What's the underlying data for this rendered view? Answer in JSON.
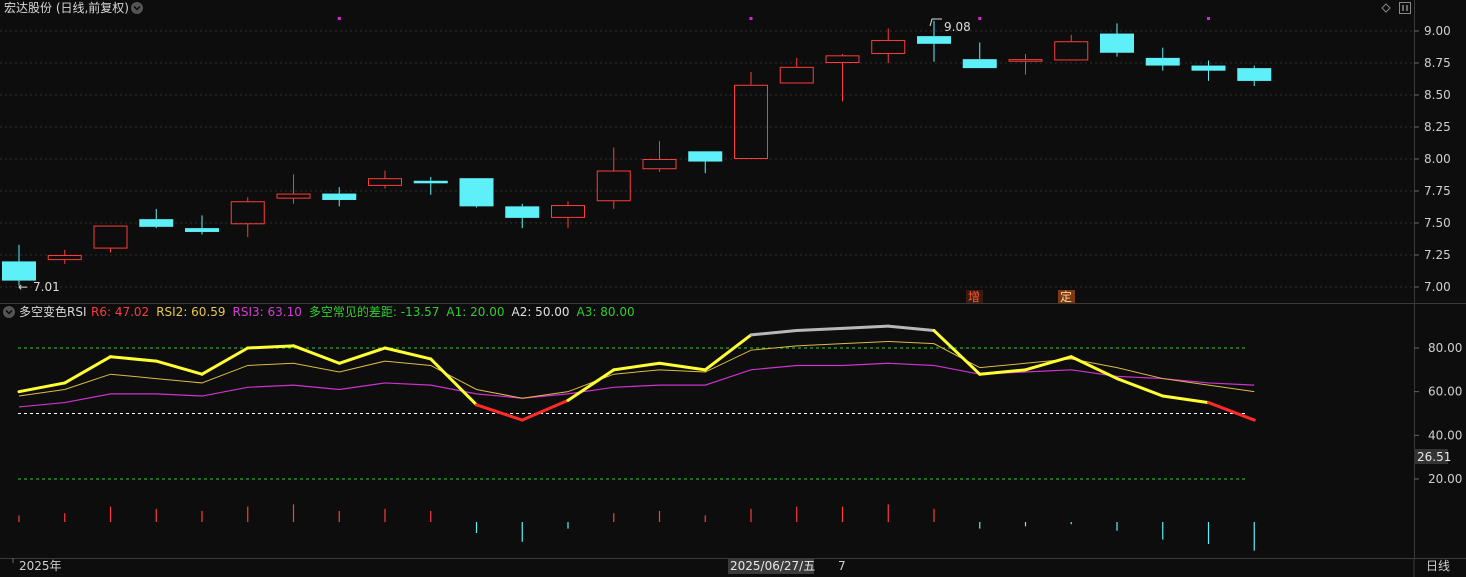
{
  "header": {
    "title": "宏达股份 (日线,前复权)",
    "rsi_title": "多空变色RSI",
    "period": "日线"
  },
  "colors": {
    "background": "#0d0d0d",
    "up": "#ff3b3b",
    "down": "#5ef0f8",
    "rsi_main": "#ffff33",
    "rsi_weak": "#ff2a2a",
    "rsi_strong": "#b8b8b8",
    "rsi2": "#ddbb44",
    "rsi3": "#cc33cc",
    "guide": "#33cc33",
    "mid": "#ffffff",
    "marker": "#e020e0"
  },
  "rsi_legend": [
    {
      "label": "R6: 47.02",
      "color": "#ff3b3b"
    },
    {
      "label": "RSI2: 60.59",
      "color": "#e8c84a"
    },
    {
      "label": "RSI3: 63.10",
      "color": "#d040d0"
    },
    {
      "label": "多空常见的差距: -13.57",
      "color": "#33cc33"
    },
    {
      "label": "A1: 20.00",
      "color": "#33cc33"
    },
    {
      "label": "A2: 50.00",
      "color": "#e0e0e0"
    },
    {
      "label": "A3: 80.00",
      "color": "#33cc33"
    }
  ],
  "annotations": {
    "high_label": "9.08",
    "low_label": "7.01",
    "events": [
      "增",
      "定"
    ],
    "crosshair_value": "26.51"
  },
  "x_axis": {
    "year_label": "2025年",
    "cursor_date": "2025/06/27/五",
    "tail_label": "7"
  },
  "chart_data": [
    {
      "type": "candlestick",
      "title": "宏达股份 (日线,前复权)",
      "y_ticks": [
        "9.00",
        "8.75",
        "8.50",
        "8.25",
        "8.00",
        "7.75",
        "7.50",
        "7.25",
        "7.00"
      ],
      "ylim": [
        6.97,
        9.1
      ],
      "candles": [
        {
          "o": 7.2,
          "h": 7.33,
          "l": 7.01,
          "c": 7.05
        },
        {
          "o": 7.21,
          "h": 7.29,
          "l": 7.18,
          "c": 7.25
        },
        {
          "o": 7.3,
          "h": 7.48,
          "l": 7.27,
          "c": 7.48
        },
        {
          "o": 7.53,
          "h": 7.61,
          "l": 7.46,
          "c": 7.47
        },
        {
          "o": 7.46,
          "h": 7.56,
          "l": 7.41,
          "c": 7.43
        },
        {
          "o": 7.49,
          "h": 7.7,
          "l": 7.39,
          "c": 7.67
        },
        {
          "o": 7.69,
          "h": 7.88,
          "l": 7.65,
          "c": 7.73
        },
        {
          "o": 7.73,
          "h": 7.78,
          "l": 7.63,
          "c": 7.68
        },
        {
          "o": 7.79,
          "h": 7.91,
          "l": 7.77,
          "c": 7.85
        },
        {
          "o": 7.83,
          "h": 7.86,
          "l": 7.72,
          "c": 7.81
        },
        {
          "o": 7.85,
          "h": 7.85,
          "l": 7.62,
          "c": 7.63
        },
        {
          "o": 7.63,
          "h": 7.65,
          "l": 7.46,
          "c": 7.54
        },
        {
          "o": 7.54,
          "h": 7.67,
          "l": 7.46,
          "c": 7.64
        },
        {
          "o": 7.67,
          "h": 8.09,
          "l": 7.61,
          "c": 7.91
        },
        {
          "o": 7.92,
          "h": 8.14,
          "l": 7.9,
          "c": 8.0
        },
        {
          "o": 8.06,
          "h": 8.06,
          "l": 7.89,
          "c": 7.98
        },
        {
          "o": 8.0,
          "h": 8.68,
          "l": 8.0,
          "c": 8.58
        },
        {
          "o": 8.59,
          "h": 8.79,
          "l": 8.59,
          "c": 8.72
        },
        {
          "o": 8.75,
          "h": 8.82,
          "l": 8.45,
          "c": 8.81
        },
        {
          "o": 8.82,
          "h": 9.02,
          "l": 8.75,
          "c": 8.93
        },
        {
          "o": 8.96,
          "h": 9.08,
          "l": 8.76,
          "c": 8.9
        },
        {
          "o": 8.78,
          "h": 8.91,
          "l": 8.71,
          "c": 8.71
        },
        {
          "o": 8.76,
          "h": 8.82,
          "l": 8.66,
          "c": 8.78
        },
        {
          "o": 8.77,
          "h": 8.97,
          "l": 8.77,
          "c": 8.92
        },
        {
          "o": 8.98,
          "h": 9.06,
          "l": 8.8,
          "c": 8.83
        },
        {
          "o": 8.79,
          "h": 8.87,
          "l": 8.69,
          "c": 8.73
        },
        {
          "o": 8.73,
          "h": 8.77,
          "l": 8.61,
          "c": 8.69
        },
        {
          "o": 8.71,
          "h": 8.73,
          "l": 8.57,
          "c": 8.61
        }
      ],
      "top_markers": [
        7,
        16,
        21,
        26
      ]
    },
    {
      "type": "line",
      "title": "多空变色RSI",
      "y_ticks": [
        "80.00",
        "60.00",
        "40.00",
        "20.00"
      ],
      "ylim": [
        0,
        100
      ],
      "guides": [
        20,
        50,
        80
      ],
      "series": [
        {
          "name": "R6",
          "values": [
            60,
            64,
            76,
            74,
            68,
            80,
            81,
            73,
            80,
            75,
            54,
            47,
            56,
            70,
            73,
            70,
            86,
            88,
            89,
            90,
            88,
            68,
            70,
            76,
            66,
            58,
            55,
            47
          ]
        },
        {
          "name": "RSI2",
          "values": [
            58,
            61,
            68,
            66,
            64,
            72,
            73,
            69,
            74,
            72,
            61,
            57,
            60,
            68,
            70,
            69,
            79,
            81,
            82,
            83,
            82,
            71,
            73,
            75,
            71,
            66,
            63,
            60
          ]
        },
        {
          "name": "RSI3",
          "values": [
            53,
            55,
            59,
            59,
            58,
            62,
            63,
            61,
            64,
            63,
            59,
            57,
            59,
            62,
            63,
            63,
            70,
            72,
            72,
            73,
            72,
            68,
            69,
            70,
            67,
            66,
            64,
            63
          ]
        }
      ],
      "bars": [
        3,
        4,
        7,
        6,
        5,
        7,
        8,
        5,
        6,
        5,
        -5,
        -9,
        -3,
        4,
        5,
        3,
        6,
        7,
        7,
        8,
        6,
        -3,
        -2,
        -1,
        -4,
        -8,
        -10,
        -13
      ]
    }
  ]
}
